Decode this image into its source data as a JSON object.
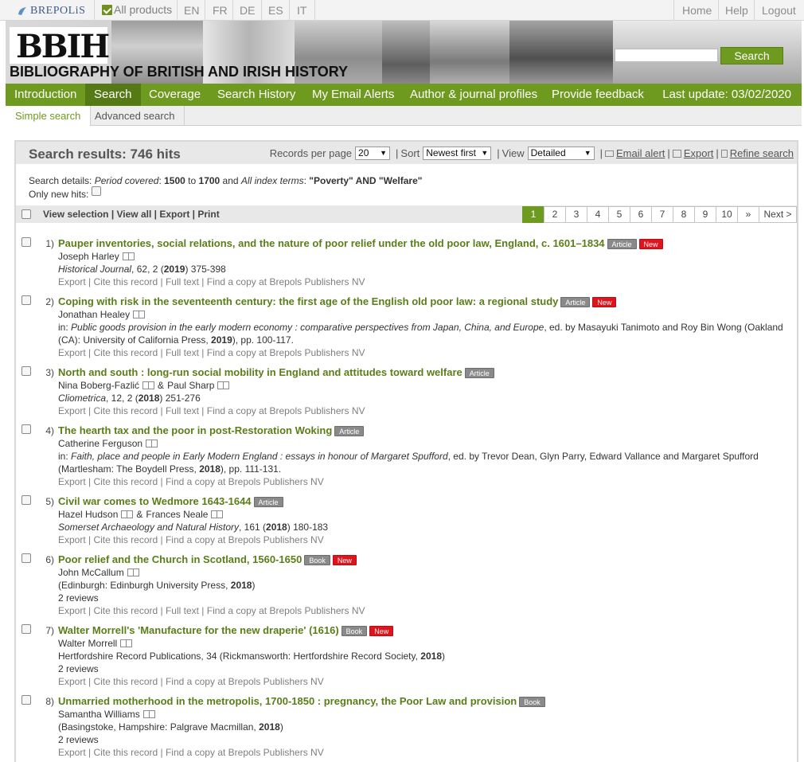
{
  "topbar": {
    "brand": "BREPOLiS",
    "products": "All products",
    "languages": [
      "EN",
      "FR",
      "DE",
      "ES",
      "IT"
    ],
    "links": [
      "Home",
      "Help",
      "Logout"
    ]
  },
  "banner": {
    "logo": "BBIH",
    "title": "BIBLIOGRAPHY OF BRITISH AND IRISH HISTORY",
    "search_button": "Search"
  },
  "nav": {
    "items": [
      "Introduction",
      "Search",
      "Coverage",
      "Search History",
      "My Email Alerts",
      "Author & journal profiles",
      "Provide feedback"
    ],
    "active": "Search",
    "last_update": "Last update: 03/02/2020"
  },
  "subnav": [
    "Simple search",
    "Advanced search"
  ],
  "results": {
    "title": "Search results: 746 hits",
    "records_label": "Records per page",
    "records_value": "20",
    "sort_label": "Sort",
    "sort_value": "Newest first",
    "view_label": "View",
    "view_value": "Detailed",
    "email_alert": "Email alert",
    "export": "Export",
    "refine": "Refine search",
    "details_prefix": "Search details:",
    "period_label": "Period covered",
    "period_from": "1500",
    "period_to": "1700",
    "index_label": "All index terms",
    "index_terms": "\"Poverty\" AND \"Welfare\"",
    "only_new": "Only new hits:",
    "selection_links": "View selection | View all | Export | Print",
    "pages": [
      "1",
      "2",
      "3",
      "4",
      "5",
      "6",
      "7",
      "8",
      "9",
      "10",
      "»",
      "Next >"
    ]
  },
  "entries": [
    {
      "num": "1)",
      "title": "Pauper inventories, social relations, and the nature of poor relief under the old poor law, England, c. 1601–1834",
      "type": "Article",
      "is_new": "New",
      "authors": [
        "Joseph Harley"
      ],
      "source_italic": "Historical Journal",
      "source_rest": ", 62, 2 (",
      "year": "2019",
      "source_tail": ") 375-398",
      "actions": "Export | Cite this record | Full text | Find a copy at Brepols Publishers NV"
    },
    {
      "num": "2)",
      "title": "Coping with risk in the seventeenth century: the first age of the English old poor law: a regional study",
      "type": "Article",
      "is_new": "New",
      "authors": [
        "Jonathan Healey"
      ],
      "in_line1_pre": "in: ",
      "in_line1_italic": "Public goods provision in the early modern economy : comparative perspectives from Japan, China, and Europe",
      "in_line1_rest": ", ed. by Masayuki Tanimoto and Roy Bin Wong (Oakland",
      "in_line2_pre": "(CA): University of California Press, ",
      "in_line2_year": "2019",
      "in_line2_rest": "), pp. 100-117.",
      "actions": "Export | Cite this record | Full text | Find a copy at Brepols Publishers NV"
    },
    {
      "num": "3)",
      "title": "North and south : long-run social mobility in England and attitudes toward welfare",
      "type": "Article",
      "authors": [
        "Nina Boberg-Fazlić",
        "Paul Sharp"
      ],
      "source_italic": "Cliometrica",
      "source_rest": ", 12, 2 (",
      "year": "2018",
      "source_tail": ") 251-276",
      "actions": "Export | Cite this record | Full text | Find a copy at Brepols Publishers NV"
    },
    {
      "num": "4)",
      "title": "The hearth tax and the poor in post-Restoration Woking",
      "type": "Article",
      "authors": [
        "Catherine Ferguson"
      ],
      "in_line1_pre": "in: ",
      "in_line1_italic": "Faith, place and people in Early Modern England : essays in honour of Margaret Spufford",
      "in_line1_rest": ", ed. by Trevor Dean, Glyn Parry, Edward Vallance and Margaret Spufford",
      "in_line2_pre": "(Martlesham: The Boydell Press, ",
      "in_line2_year": "2018",
      "in_line2_rest": "), pp. 111-131.",
      "actions": "Export | Cite this record | Find a copy at Brepols Publishers NV"
    },
    {
      "num": "5)",
      "title": "Civil war comes to Wedmore 1643-1644",
      "type": "Article",
      "authors": [
        "Hazel Hudson",
        "Frances Neale"
      ],
      "source_italic": "Somerset Archaeology and Natural History",
      "source_rest": ", 161 (",
      "year": "2018",
      "source_tail": ") 180-183",
      "actions": "Export | Cite this record | Find a copy at Brepols Publishers NV"
    },
    {
      "num": "6)",
      "title": "Poor relief and the Church in Scotland, 1560-1650",
      "type": "Book",
      "is_new": "New",
      "authors": [
        "John McCallum"
      ],
      "pub_pre": "(Edinburgh: Edinburgh University Press, ",
      "year": "2018",
      "pub_tail": ")",
      "reviews": "2 reviews",
      "actions": "Export | Cite this record | Full text | Find a copy at Brepols Publishers NV"
    },
    {
      "num": "7)",
      "title": "Walter Morrell's 'Manufacture for the new draperie' (1616)",
      "type": "Book",
      "is_new": "New",
      "authors": [
        "Walter Morrell"
      ],
      "pub_pre": "Hertfordshire Record Publications, 34 (Rickmansworth: Hertfordshire Record Society, ",
      "year": "2018",
      "pub_tail": ")",
      "reviews": "2 reviews",
      "actions": "Export | Cite this record | Find a copy at Brepols Publishers NV"
    },
    {
      "num": "8)",
      "title": "Unmarried motherhood in the metropolis, 1700-1850 : pregnancy, the Poor Law and provision",
      "type": "Book",
      "authors": [
        "Samantha Williams"
      ],
      "pub_pre": "(Basingstoke, Hampshire: Palgrave Macmillan, ",
      "year": "2018",
      "pub_tail": ")",
      "reviews": "2 reviews",
      "actions": "Export | Cite this record | Find a copy at Brepols Publishers NV"
    }
  ]
}
